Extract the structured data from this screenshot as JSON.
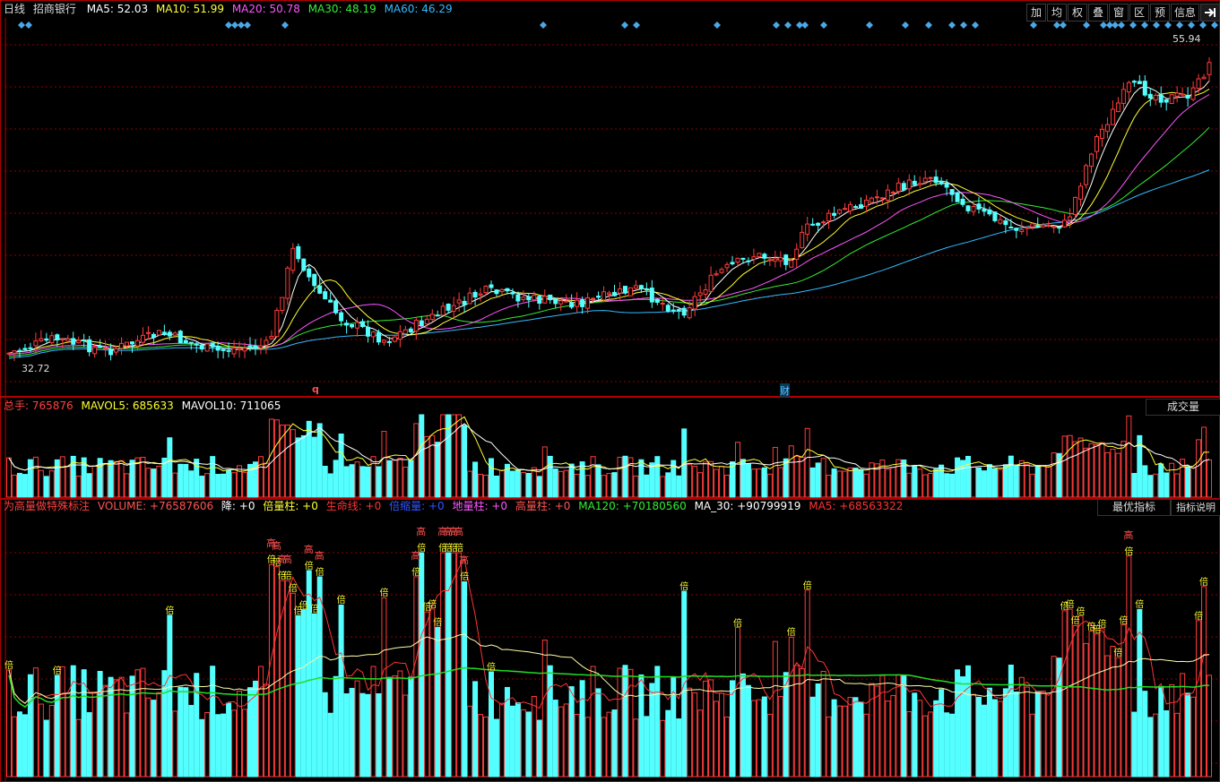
{
  "price_header": {
    "period": "日线",
    "stock": "招商银行",
    "ma": [
      {
        "label": "MA5: 52.03",
        "color": "#ffffff"
      },
      {
        "label": "MA10: 51.99",
        "color": "#ffff33"
      },
      {
        "label": "MA20: 50.78",
        "color": "#ff55ff"
      },
      {
        "label": "MA30: 48.19",
        "color": "#33ee33"
      },
      {
        "label": "MA60: 46.29",
        "color": "#33bbff"
      }
    ]
  },
  "toolbar": [
    "加",
    "均",
    "权",
    "叠",
    "窗",
    "区",
    "预",
    "信息",
    "exit-icon"
  ],
  "price_labels": {
    "high": "55.94",
    "low": "32.72",
    "marker_q": "q",
    "marker_cai": "财"
  },
  "volume_header": {
    "total": "总手: 765876",
    "mavol5": "MAVOL5: 685633",
    "mavol10": "MAVOL10: 711065",
    "dropdown": "成交量"
  },
  "indicator_header": {
    "title": "为高量做特殊标注",
    "items": [
      {
        "label": "VOLUME: +76587606",
        "color": "#ff5555"
      },
      {
        "label": "降: +0",
        "color": "#ffffff"
      },
      {
        "label": "倍量柱: +0",
        "color": "#ffff33"
      },
      {
        "label": "生命线: +0",
        "color": "#ff3333"
      },
      {
        "label": "倍缩量: +0",
        "color": "#3355ff"
      },
      {
        "label": "地量柱: +0",
        "color": "#ff55ff"
      },
      {
        "label": "高量柱: +0",
        "color": "#ff5555"
      },
      {
        "label": "MA120: +70180560",
        "color": "#33ee33"
      },
      {
        "label": "MA_30: +90799919",
        "color": "#ffffff"
      },
      {
        "label": "MA5: +68563322",
        "color": "#ff3333"
      }
    ],
    "buttons": [
      "最优指标",
      "指标说明"
    ]
  },
  "indicator_labels": {
    "gao": "高",
    "bei": "倍"
  },
  "colors": {
    "up": "#ff3c3c",
    "down": "#54ffff",
    "grid": "#8b0000",
    "border": "#b00000",
    "diamond": "#4aa8e8"
  }
}
